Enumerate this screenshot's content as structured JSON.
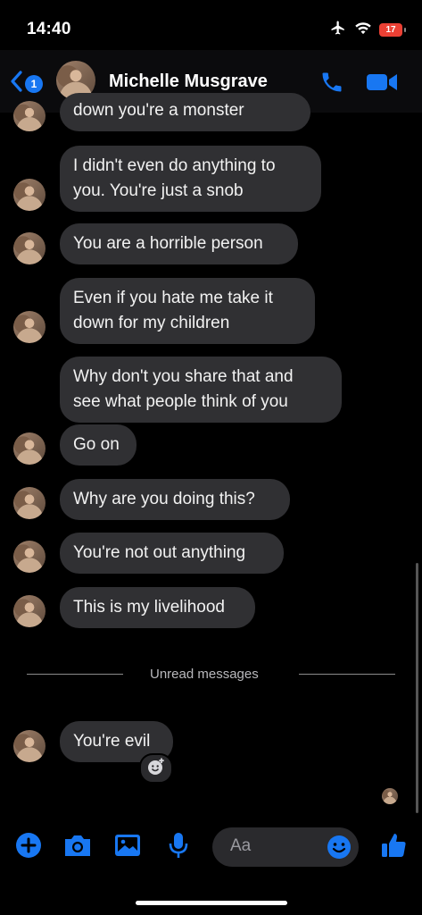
{
  "status_bar": {
    "time": "14:40",
    "battery": "17"
  },
  "header": {
    "back_badge": "1",
    "contact_name": "Michelle Musgrave"
  },
  "messages": [
    {
      "text": "down you're a monster"
    },
    {
      "text_line1": "I didn't even do anything to",
      "text_line2": "you. You're just a snob"
    },
    {
      "text": "You are a horrible person"
    },
    {
      "text_line1": "Even if you hate me take it",
      "text_line2": "down for my children"
    },
    {
      "text_line1": "Why don't you share that and",
      "text_line2": "see what people think of you"
    },
    {
      "text": "Go on"
    },
    {
      "text": "Why are you doing this?"
    },
    {
      "text": "You're not out anything"
    },
    {
      "text": "This is my livelihood"
    },
    {
      "text": "You're evil"
    }
  ],
  "divider": {
    "label": "Unread messages"
  },
  "composer": {
    "placeholder": "Aa"
  },
  "colors": {
    "accent": "#1877f2",
    "bubble": "#303033",
    "battery": "#eb4034"
  },
  "icons": [
    "airplane-icon",
    "wifi-icon",
    "chevron-left-icon",
    "phone-icon",
    "video-camera-icon",
    "plus-icon",
    "camera-icon",
    "image-icon",
    "microphone-icon",
    "emoji-icon",
    "thumbs-up-icon",
    "add-reaction-icon"
  ]
}
